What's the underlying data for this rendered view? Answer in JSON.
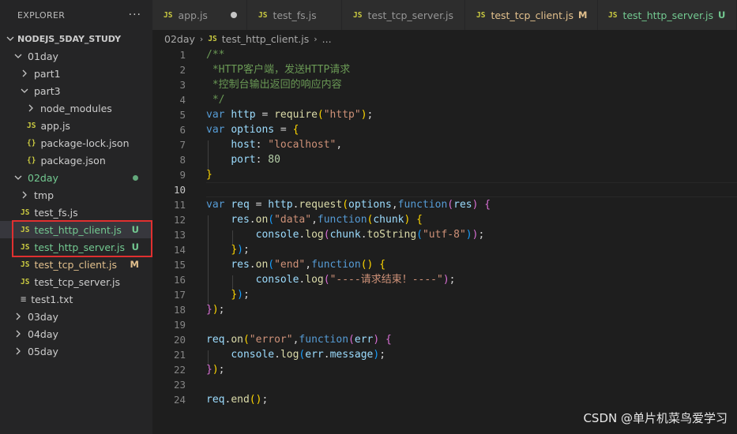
{
  "sidebar": {
    "title": "EXPLORER",
    "more": "···",
    "project": "NODEJS_5DAY_STUDY",
    "items": [
      {
        "label": "01day"
      },
      {
        "label": "part1"
      },
      {
        "label": "part3"
      },
      {
        "label": "node_modules"
      },
      {
        "label": "app.js",
        "icon": "JS"
      },
      {
        "label": "package-lock.json",
        "icon": "{}"
      },
      {
        "label": "package.json",
        "icon": "{}"
      },
      {
        "label": "02day"
      },
      {
        "label": "tmp"
      },
      {
        "label": "test_fs.js",
        "icon": "JS"
      },
      {
        "label": "test_http_client.js",
        "icon": "JS",
        "badge": "U"
      },
      {
        "label": "test_http_server.js",
        "icon": "JS",
        "badge": "U"
      },
      {
        "label": "test_tcp_client.js",
        "icon": "JS",
        "badge": "M"
      },
      {
        "label": "test_tcp_server.js",
        "icon": "JS"
      },
      {
        "label": "test1.txt",
        "icon": "≡"
      },
      {
        "label": "03day"
      },
      {
        "label": "04day"
      },
      {
        "label": "05day"
      }
    ]
  },
  "tabs": [
    {
      "label": "app.js",
      "icon": "JS"
    },
    {
      "label": "test_fs.js",
      "icon": "JS"
    },
    {
      "label": "test_tcp_server.js",
      "icon": "JS"
    },
    {
      "label": "test_tcp_client.js",
      "icon": "JS",
      "badge": "M"
    },
    {
      "label": "test_http_server.js",
      "icon": "JS",
      "badge": "U"
    }
  ],
  "breadcrumb": {
    "folder": "02day",
    "file": "test_http_client.js",
    "icon": "JS",
    "more": "..."
  },
  "editor": {
    "line_numbers": [
      "1",
      "2",
      "3",
      "4",
      "5",
      "6",
      "7",
      "8",
      "9",
      "10",
      "11",
      "12",
      "13",
      "14",
      "15",
      "16",
      "17",
      "18",
      "19",
      "20",
      "21",
      "22",
      "23",
      "24"
    ],
    "code": {
      "l1": "/**",
      "l2": " *HTTP客户端，发送HTTP请求",
      "l3": " *控制台输出返回的响应内容",
      "l4": " */",
      "l5_kw": "var",
      "l5_var": "http",
      "l5_eq": " = ",
      "l5_fn": "require",
      "l5_str": "\"http\"",
      "l5_end": ";",
      "l6_kw": "var",
      "l6_var": "options",
      "l6_eq": " = ",
      "l7_key": "host",
      "l7_str": "\"localhost\"",
      "l8_key": "port",
      "l8_num": "80",
      "l11_var": "req",
      "l11_obj": "http",
      "l11_fn": "request",
      "l11_arg": "options",
      "l11_kw": "function",
      "l11_p": "res",
      "l12_obj": "res",
      "l12_fn": "on",
      "l12_str": "\"data\"",
      "l12_kw": "function",
      "l12_p": "chunk",
      "l13_obj": "console",
      "l13_fn": "log",
      "l13_arg": "chunk",
      "l13_fn2": "toString",
      "l13_str": "\"utf-8\"",
      "l15_obj": "res",
      "l15_fn": "on",
      "l15_str": "\"end\"",
      "l15_kw": "function",
      "l16_obj": "console",
      "l16_fn": "log",
      "l16_str": "\"----请求结束！----\"",
      "l20_obj": "req",
      "l20_fn": "on",
      "l20_str": "\"error\"",
      "l20_kw": "function",
      "l20_p": "err",
      "l21_obj": "console",
      "l21_fn": "log",
      "l21_arg": "err",
      "l21_prop": "message",
      "l24_obj": "req",
      "l24_fn": "end"
    }
  },
  "watermark": "CSDN @单片机菜鸟爱学习",
  "colors": {
    "git_untracked": "#73c991",
    "git_modified": "#e2c08d",
    "highlight_box": "#e03030"
  }
}
